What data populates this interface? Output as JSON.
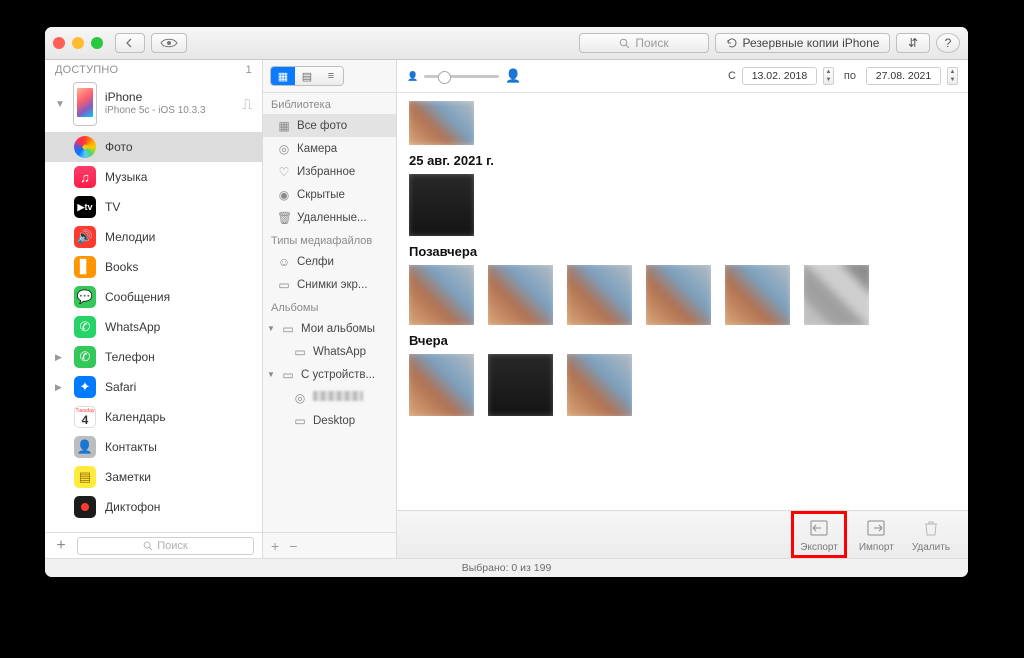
{
  "titlebar": {
    "search_placeholder": "Поиск",
    "backups_label": "Резервные копии iPhone",
    "swap_glyph": "⇵",
    "help_glyph": "?"
  },
  "sidebar": {
    "header": "ДОСТУПНО",
    "count": "1",
    "device_name": "iPhone",
    "device_sub": "iPhone 5c - iOS 10.3.3",
    "items": [
      {
        "label": "Фото",
        "ico": "photos",
        "sel": true,
        "chev": ""
      },
      {
        "label": "Музыка",
        "ico": "music",
        "sel": false,
        "chev": ""
      },
      {
        "label": "TV",
        "ico": "tv",
        "sel": false,
        "chev": ""
      },
      {
        "label": "Мелодии",
        "ico": "mel",
        "sel": false,
        "chev": ""
      },
      {
        "label": "Books",
        "ico": "books",
        "sel": false,
        "chev": ""
      },
      {
        "label": "Сообщения",
        "ico": "msg",
        "sel": false,
        "chev": ""
      },
      {
        "label": "WhatsApp",
        "ico": "wa",
        "sel": false,
        "chev": ""
      },
      {
        "label": "Телефон",
        "ico": "phonec",
        "sel": false,
        "chev": "▶"
      },
      {
        "label": "Safari",
        "ico": "safari",
        "sel": false,
        "chev": "▶"
      },
      {
        "label": "Календарь",
        "ico": "cal",
        "sel": false,
        "chev": ""
      },
      {
        "label": "Контакты",
        "ico": "cont",
        "sel": false,
        "chev": ""
      },
      {
        "label": "Заметки",
        "ico": "notes",
        "sel": false,
        "chev": ""
      },
      {
        "label": "Диктофон",
        "ico": "voice",
        "sel": false,
        "chev": ""
      }
    ],
    "footer_search_placeholder": "Поиск"
  },
  "midcol": {
    "sections": [
      {
        "title": "Библиотека",
        "items": [
          {
            "label": "Все фото",
            "ico": "▦",
            "sel": true
          },
          {
            "label": "Камера",
            "ico": "◎"
          },
          {
            "label": "Избранное",
            "ico": "♡"
          },
          {
            "label": "Скрытые",
            "ico": "◉"
          },
          {
            "label": "Удаленные...",
            "ico": "🗑"
          }
        ]
      },
      {
        "title": "Типы медиафайлов",
        "items": [
          {
            "label": "Селфи",
            "ico": "☺"
          },
          {
            "label": "Снимки экр...",
            "ico": "▭"
          }
        ]
      },
      {
        "title": "Альбомы",
        "items": [
          {
            "label": "Мои альбомы",
            "ico": "▭",
            "tri": "▼"
          },
          {
            "label": "WhatsApp",
            "ico": "▭",
            "lvl": 2
          },
          {
            "label": "С устройств...",
            "ico": "▭",
            "tri": "▼"
          },
          {
            "label": "",
            "ico": "◎",
            "lvl": 2,
            "pixelated": true
          },
          {
            "label": "Desktop",
            "ico": "▭",
            "lvl": 2
          }
        ]
      }
    ]
  },
  "main_toolbar": {
    "from_label": "С",
    "from_date": "13.02. 2018",
    "to_label": "по",
    "to_date": "27.08. 2021"
  },
  "content_groups": [
    {
      "title": "",
      "thumbs": [
        {
          "cls": "half br"
        }
      ]
    },
    {
      "title": "25 авг. 2021 г.",
      "thumbs": [
        {
          "cls": "tall dark"
        }
      ]
    },
    {
      "title": "Позавчера",
      "thumbs": [
        {
          "cls": "br"
        },
        {
          "cls": "br"
        },
        {
          "cls": "br"
        },
        {
          "cls": "br"
        },
        {
          "cls": "br"
        },
        {
          "cls": ""
        }
      ]
    },
    {
      "title": "Вчера",
      "thumbs": [
        {
          "cls": "tall br"
        },
        {
          "cls": "tall dark"
        },
        {
          "cls": "tall br"
        }
      ]
    }
  ],
  "bottom": {
    "export": "Экспорт",
    "import": "Импорт",
    "delete": "Удалить"
  },
  "status": "Выбрано: 0 из 199",
  "cal_icon": {
    "top": "Tuesday",
    "day": "4"
  }
}
